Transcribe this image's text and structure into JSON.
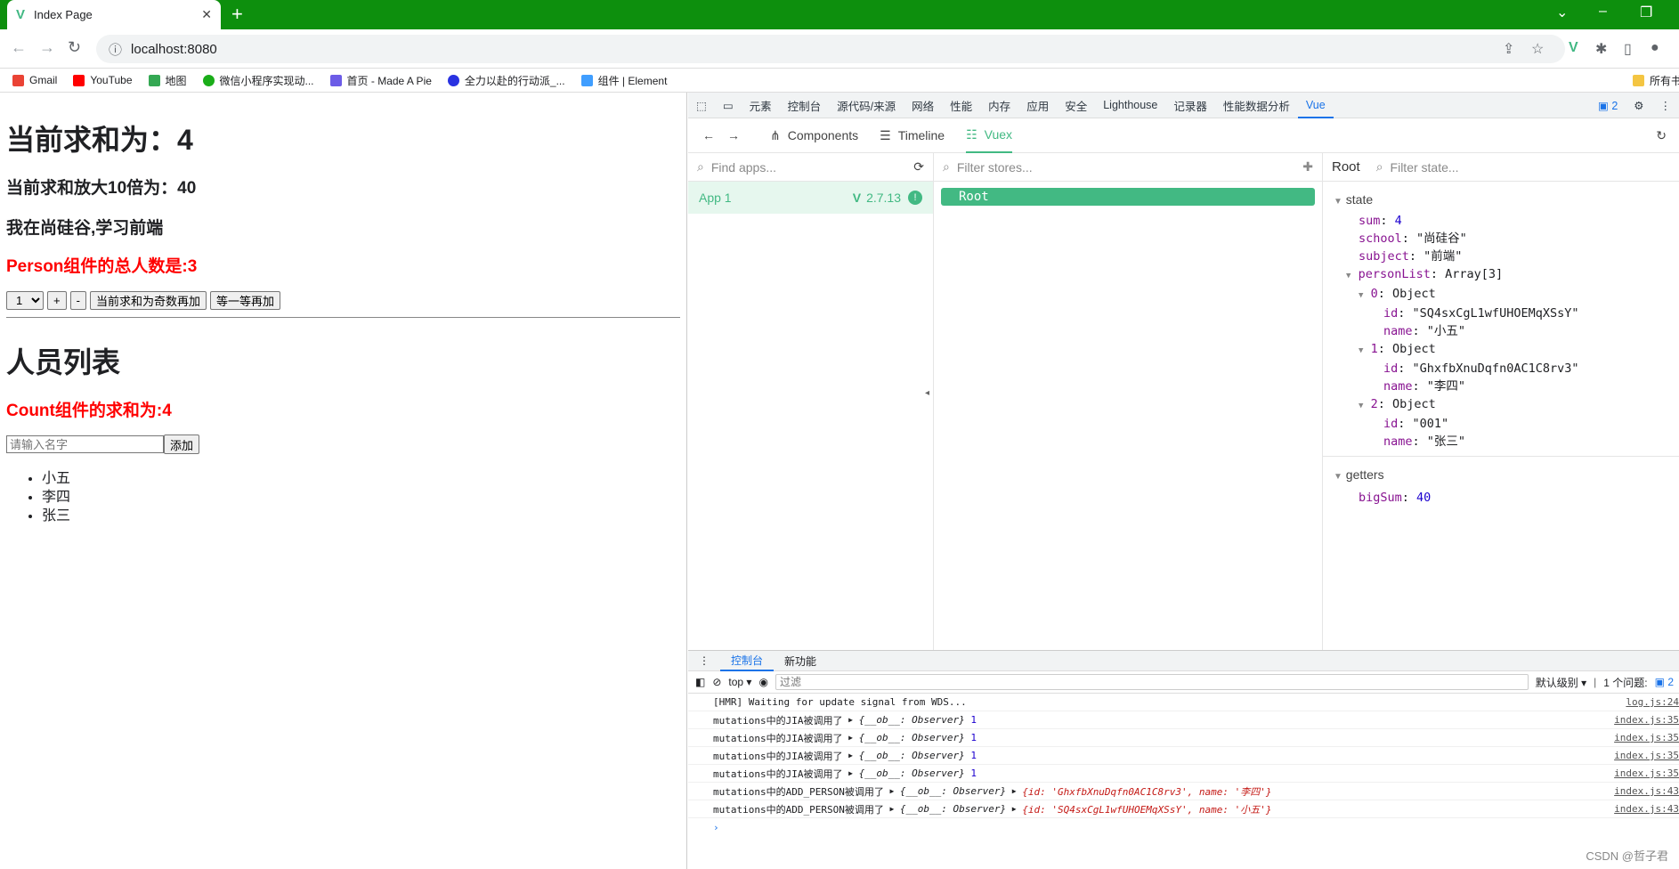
{
  "browser": {
    "tab_title": "Index Page",
    "url": "localhost:8080",
    "bookmarks": [
      "Gmail",
      "YouTube",
      "地图",
      "微信小程序实现动...",
      "首页 - Made A Pie",
      "全力以赴的行动派_...",
      "组件 | Element",
      "所有书"
    ]
  },
  "page": {
    "sum_heading": "当前求和为：4",
    "big_sum": "当前求和放大10倍为：40",
    "school": "我在尚硅谷,学习前端",
    "person_count": "Person组件的总人数是:3",
    "select_value": "1",
    "btn_plus": "+",
    "btn_minus": "-",
    "btn_odd": "当前求和为奇数再加",
    "btn_wait": "等一等再加",
    "list_title": "人员列表",
    "count_sum": "Count组件的求和为:4",
    "name_placeholder": "请输入名字",
    "btn_add": "添加",
    "persons": [
      "小五",
      "李四",
      "张三"
    ]
  },
  "devtools": {
    "tabs": [
      "元素",
      "控制台",
      "源代码/来源",
      "网络",
      "性能",
      "内存",
      "应用",
      "安全",
      "Lighthouse",
      "记录器",
      "性能数据分析",
      "Vue"
    ],
    "active_tab": "Vue",
    "issue_count": "2",
    "vue_tabs": [
      "Components",
      "Timeline",
      "Vuex"
    ],
    "find_apps": "Find apps...",
    "app_name": "App 1",
    "vue_version": "2.7.13",
    "filter_stores": "Filter stores...",
    "store_root": "Root",
    "state_panel_title": "Root",
    "filter_state": "Filter state...",
    "state_label": "state",
    "state": {
      "sum_key": "sum",
      "sum_val": "4",
      "school_key": "school",
      "school_val": "\"尚硅谷\"",
      "subject_key": "subject",
      "subject_val": "\"前端\"",
      "personList_key": "personList",
      "personList_val": "Array[3]",
      "p0_key": "0",
      "p0_id": "\"SQ4sxCgL1wfUHOEMqXSsY\"",
      "p0_name": "\"小五\"",
      "p1_key": "1",
      "p1_id": "\"GhxfbXnuDqfn0AC1C8rv3\"",
      "p1_name": "\"李四\"",
      "p2_key": "2",
      "p2_id": "\"001\"",
      "p2_name": "\"张三\"",
      "object_label": "Object",
      "id_key": "id",
      "name_key": "name"
    },
    "getters_label": "getters",
    "getter_key": "bigSum",
    "getter_val": "40"
  },
  "console": {
    "drawer_tabs": [
      "控制台",
      "新功能"
    ],
    "context": "top",
    "filter_placeholder": "过滤",
    "level": "默认级别",
    "issues": "1 个问题:",
    "issues_count": "2",
    "logs": [
      {
        "text": "[HMR] Waiting for update signal from WDS...",
        "src": "log.js:24"
      },
      {
        "text": "mutations中的JIA被调用了",
        "obj": "{__ob__: Observer}",
        "extra": "1",
        "src": "index.js:35"
      },
      {
        "text": "mutations中的JIA被调用了",
        "obj": "{__ob__: Observer}",
        "extra": "1",
        "src": "index.js:35"
      },
      {
        "text": "mutations中的JIA被调用了",
        "obj": "{__ob__: Observer}",
        "extra": "1",
        "src": "index.js:35"
      },
      {
        "text": "mutations中的JIA被调用了",
        "obj": "{__ob__: Observer}",
        "extra": "1",
        "src": "index.js:35"
      },
      {
        "text": "mutations中的ADD_PERSON被调用了",
        "obj": "{__ob__: Observer}",
        "extra": "{id: 'GhxfbXnuDqfn0AC1C8rv3', name: '李四'}",
        "src": "index.js:43"
      },
      {
        "text": "mutations中的ADD_PERSON被调用了",
        "obj": "{__ob__: Observer}",
        "extra": "{id: 'SQ4sxCgL1wfUHOEMqXSsY', name: '小五'}",
        "src": "index.js:43"
      }
    ],
    "watermark": "CSDN @哲子君"
  }
}
